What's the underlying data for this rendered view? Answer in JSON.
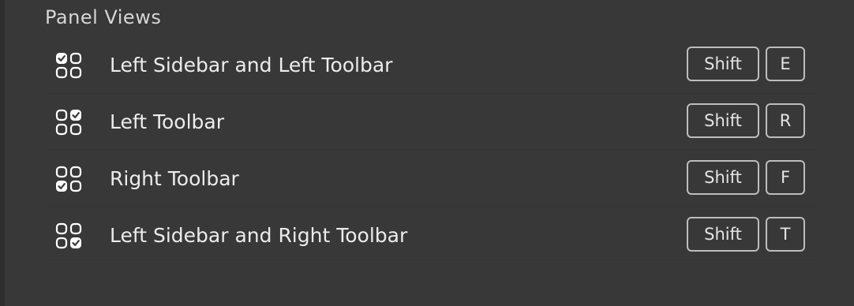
{
  "section": {
    "title": "Panel Views"
  },
  "rows": [
    {
      "label": "Left Sidebar and Left Toolbar",
      "modifier": "Shift",
      "key": "E",
      "icon": "layout-grid-check-top-left-icon"
    },
    {
      "label": "Left Toolbar",
      "modifier": "Shift",
      "key": "R",
      "icon": "layout-grid-check-top-right-icon"
    },
    {
      "label": "Right Toolbar",
      "modifier": "Shift",
      "key": "F",
      "icon": "layout-grid-check-bottom-left-icon"
    },
    {
      "label": "Left Sidebar and Right Toolbar",
      "modifier": "Shift",
      "key": "T",
      "icon": "layout-grid-check-bottom-right-icon"
    }
  ],
  "colors": {
    "background": "#383838",
    "text": "#ececec",
    "key_border": "#bdbdbd"
  }
}
